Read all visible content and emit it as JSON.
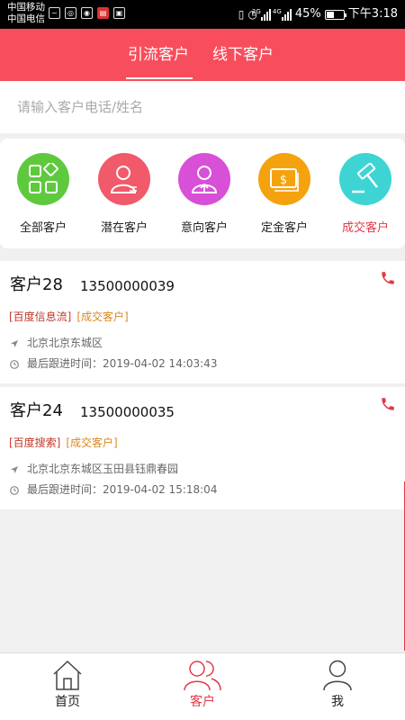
{
  "status_bar": {
    "carrier_1": "中国移动",
    "carrier_2": "中国电信",
    "battery_text": "45%",
    "time": "下午3:18",
    "signal_1_label": "2G",
    "signal_2_label": "4G",
    "battery_level": 0.45,
    "icons": [
      "activity-icon",
      "browser-icon",
      "wechat-icon",
      "news-icon",
      "cat-icon",
      "vibrate-icon",
      "alarm-icon",
      "signal-icon",
      "signal-icon",
      "battery-icon"
    ]
  },
  "header": {
    "tabs": [
      {
        "label": "引流客户",
        "active": true
      },
      {
        "label": "线下客户",
        "active": false
      }
    ],
    "background_color": "#f84d5c"
  },
  "search": {
    "placeholder": "请输入客户电话/姓名",
    "value": ""
  },
  "categories": [
    {
      "label": "全部客户",
      "color": "#5ec93d",
      "icon": "grid-icon",
      "active": false
    },
    {
      "label": "潜在客户",
      "color": "#f05a6a",
      "icon": "person-icon",
      "active": false
    },
    {
      "label": "意向客户",
      "color": "#d84fd8",
      "icon": "person-arrow-icon",
      "active": false
    },
    {
      "label": "定金客户",
      "color": "#f5a20f",
      "icon": "money-icon",
      "active": false
    },
    {
      "label": "成交客户",
      "color": "#3fd4d4",
      "icon": "gavel-icon",
      "active": true
    }
  ],
  "customers": [
    {
      "name": "客户28",
      "phone": "13500000039",
      "source_tag": "[百度信息流]",
      "status_tag": "[成交客户]",
      "address": "北京北京东城区",
      "last_follow": "最后跟进时间：2019-04-02 14:03:43"
    },
    {
      "name": "客户24",
      "phone": "13500000035",
      "source_tag": "[百度搜索]",
      "status_tag": "[成交客户]",
      "address": "北京北京东城区玉田县钰鼎春园",
      "last_follow": "最后跟进时间：2019-04-02 15:18:04"
    }
  ],
  "bottom_nav": [
    {
      "label": "首页",
      "icon": "home-icon",
      "active": false
    },
    {
      "label": "客户",
      "icon": "customers-icon",
      "active": true
    },
    {
      "label": "我",
      "icon": "profile-icon",
      "active": false
    }
  ],
  "accent_color": "#e23a48"
}
